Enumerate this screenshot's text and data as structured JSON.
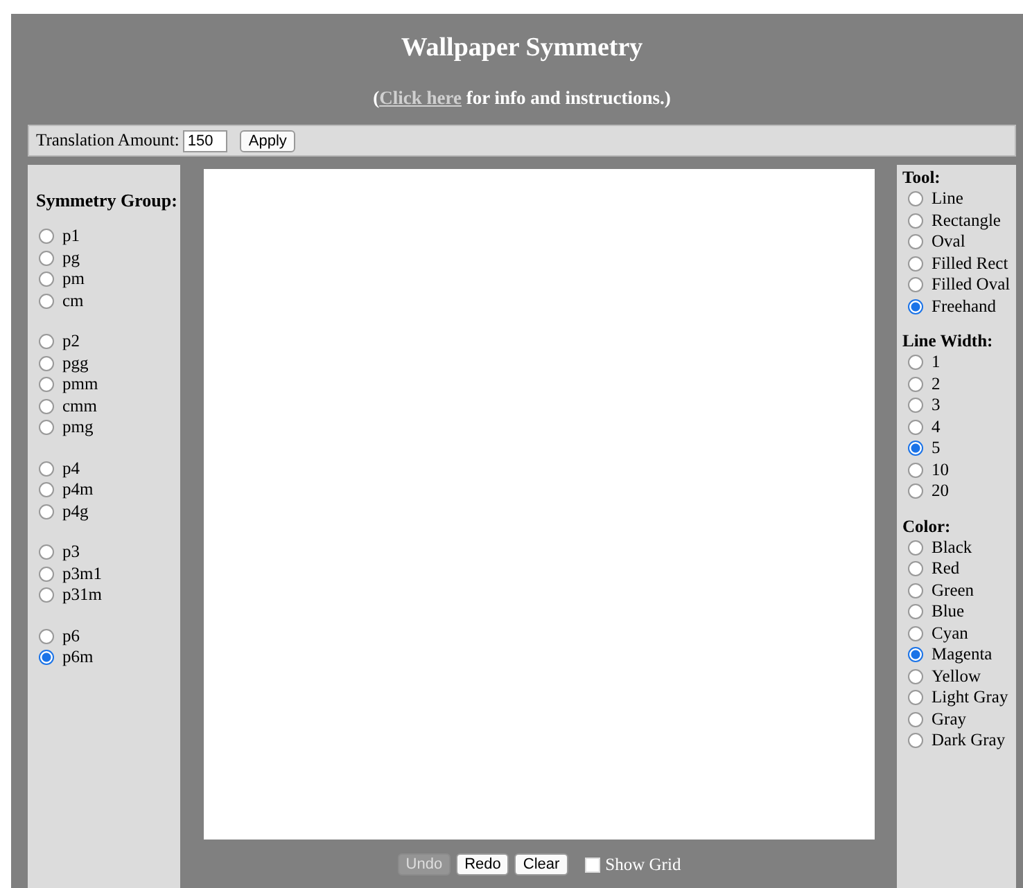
{
  "header": {
    "title": "Wallpaper Symmetry",
    "info_prefix": "(",
    "info_link": "Click here",
    "info_suffix": " for info and instructions.)"
  },
  "toolbar": {
    "label": "Translation Amount:",
    "value": "150",
    "button": "Apply"
  },
  "symmetry": {
    "title": "Symmetry Group:",
    "groups": [
      [
        {
          "label": "p1",
          "selected": false
        },
        {
          "label": "pg",
          "selected": false
        },
        {
          "label": "pm",
          "selected": false
        },
        {
          "label": "cm",
          "selected": false
        }
      ],
      [
        {
          "label": "p2",
          "selected": false
        },
        {
          "label": "pgg",
          "selected": false
        },
        {
          "label": "pmm",
          "selected": false
        },
        {
          "label": "cmm",
          "selected": false
        },
        {
          "label": "pmg",
          "selected": false
        }
      ],
      [
        {
          "label": "p4",
          "selected": false
        },
        {
          "label": "p4m",
          "selected": false
        },
        {
          "label": "p4g",
          "selected": false
        }
      ],
      [
        {
          "label": "p3",
          "selected": false
        },
        {
          "label": "p3m1",
          "selected": false
        },
        {
          "label": "p31m",
          "selected": false
        }
      ],
      [
        {
          "label": "p6",
          "selected": false
        },
        {
          "label": "p6m",
          "selected": true
        }
      ]
    ]
  },
  "options": [
    {
      "title": "Tool:",
      "items": [
        {
          "label": "Line",
          "selected": false
        },
        {
          "label": "Rectangle",
          "selected": false
        },
        {
          "label": "Oval",
          "selected": false
        },
        {
          "label": "Filled Rect",
          "selected": false
        },
        {
          "label": "Filled Oval",
          "selected": false
        },
        {
          "label": "Freehand",
          "selected": true
        }
      ]
    },
    {
      "title": "Line Width:",
      "items": [
        {
          "label": "1",
          "selected": false
        },
        {
          "label": "2",
          "selected": false
        },
        {
          "label": "3",
          "selected": false
        },
        {
          "label": "4",
          "selected": false
        },
        {
          "label": "5",
          "selected": true
        },
        {
          "label": "10",
          "selected": false
        },
        {
          "label": "20",
          "selected": false
        }
      ]
    },
    {
      "title": "Color:",
      "items": [
        {
          "label": "Black",
          "selected": false
        },
        {
          "label": "Red",
          "selected": false
        },
        {
          "label": "Green",
          "selected": false
        },
        {
          "label": "Blue",
          "selected": false
        },
        {
          "label": "Cyan",
          "selected": false
        },
        {
          "label": "Magenta",
          "selected": true
        },
        {
          "label": "Yellow",
          "selected": false
        },
        {
          "label": "Light Gray",
          "selected": false
        },
        {
          "label": "Gray",
          "selected": false
        },
        {
          "label": "Dark Gray",
          "selected": false
        }
      ]
    }
  ],
  "bottom": {
    "buttons": [
      {
        "label": "Undo",
        "disabled": true
      },
      {
        "label": "Redo",
        "disabled": false
      },
      {
        "label": "Clear",
        "disabled": false
      }
    ],
    "grid": {
      "label": "Show Grid",
      "checked": false
    }
  }
}
